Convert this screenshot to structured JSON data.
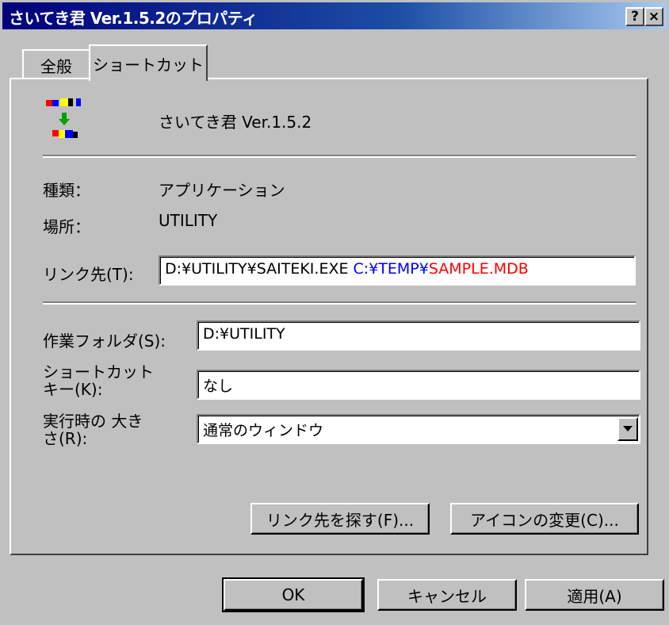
{
  "window": {
    "title": "さいてき君 Ver.1.5.2のプロパティ",
    "help_button": "?",
    "close_button": "×"
  },
  "tabs": [
    {
      "label": "全般"
    },
    {
      "label": "ショートカット"
    }
  ],
  "app": {
    "name": "さいてき君 Ver.1.5.2",
    "icon": "application-icon"
  },
  "info": {
    "type_label": "種類：",
    "type_value": "アプリケーション",
    "location_label": "場所：",
    "location_value": "UTILITY"
  },
  "link": {
    "label": "リンク先(T):",
    "part1": "D:¥UTILITY¥SAITEKI.EXE",
    "part2": "C:¥TEMP¥",
    "part3": "SAMPLE.MDB",
    "color_part2": "#0000ff",
    "color_part3": "#ff0000"
  },
  "workdir": {
    "label": "作業フォルダ(S):",
    "value": "D:¥UTILITY"
  },
  "shortcut": {
    "label": "ショートカット キー(K):",
    "value": "なし"
  },
  "run": {
    "label": "実行時の 大きさ(R):",
    "value": "通常のウィンドウ"
  },
  "buttons": {
    "find_target": "リンク先を探す(F)...",
    "change_icon": "アイコンの変更(C)...",
    "ok": "OK",
    "cancel": "キャンセル",
    "apply": "適用(A)"
  }
}
